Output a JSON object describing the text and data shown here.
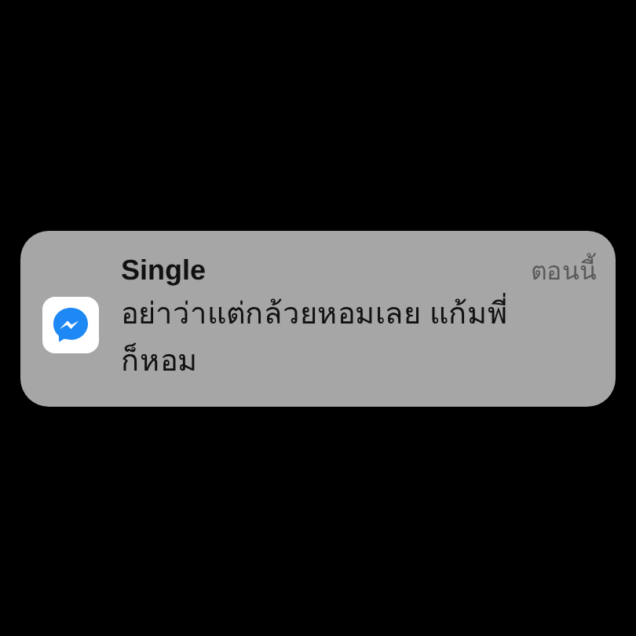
{
  "notification": {
    "title": "Single",
    "time": "ตอนนี้",
    "message": "อย่าว่าแต่กล้วยหอมเลย แก้มพี่ก็หอม"
  }
}
